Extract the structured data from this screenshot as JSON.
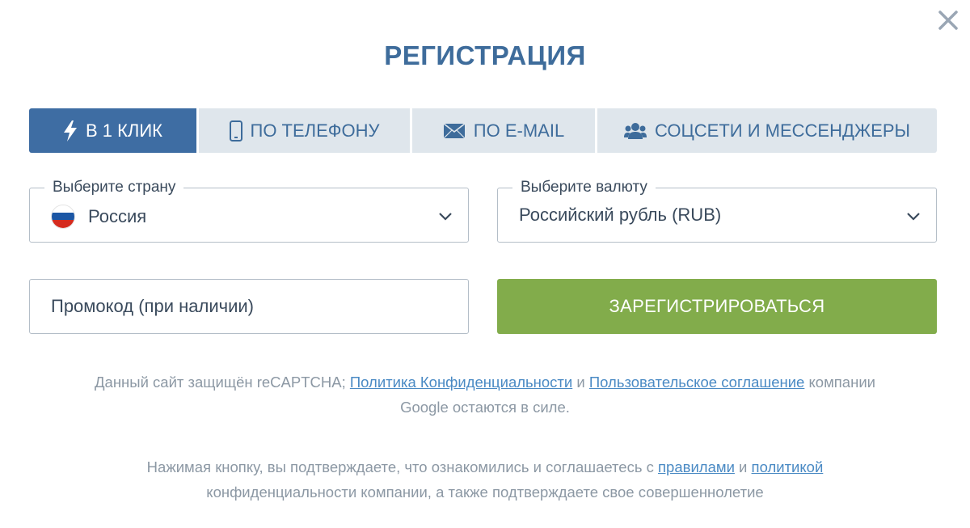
{
  "modal": {
    "title": "РЕГИСТРАЦИЯ",
    "close_icon": "close-icon"
  },
  "tabs": [
    {
      "label": "В 1 КЛИК",
      "icon": "lightning-icon",
      "active": true
    },
    {
      "label": "ПО ТЕЛЕФОНУ",
      "icon": "phone-icon",
      "active": false
    },
    {
      "label": "ПО E-MAIL",
      "icon": "envelope-icon",
      "active": false
    },
    {
      "label": "СОЦСЕТИ И МЕССЕНДЖЕРЫ",
      "icon": "users-icon",
      "active": false
    }
  ],
  "country": {
    "label": "Выберите страну",
    "value": "Россия",
    "flag_colors": [
      "#ffffff",
      "#1c57a5",
      "#d52b1e"
    ]
  },
  "currency": {
    "label": "Выберите валюту",
    "value": "Российский рубль (RUB)"
  },
  "promo": {
    "placeholder": "Промокод (при наличии)",
    "value": ""
  },
  "register_button": "ЗАРЕГИСТРИРОВАТЬСЯ",
  "recaptcha_note": {
    "prefix": "Данный сайт защищён reCAPTCHA; ",
    "privacy_link": "Политика Конфиденциальности",
    "and": " и ",
    "terms_link": "Пользовательское соглашение",
    "suffix": " компании",
    "line2": "Google остаются в силе."
  },
  "consent_note": {
    "prefix": "Нажимая кнопку, вы подтверждаете, что ознакомились и соглашаетесь с ",
    "rules_link": "правилами",
    "and": " и ",
    "policy_link": "политикой",
    "line2": "конфиденциальности компании, а также подтверждаете свое совершеннолетие"
  },
  "colors": {
    "accent": "#3e6da3",
    "tab_inactive": "#dfe6ec",
    "register_green": "#82ac4b",
    "link": "#4a8ac4"
  }
}
